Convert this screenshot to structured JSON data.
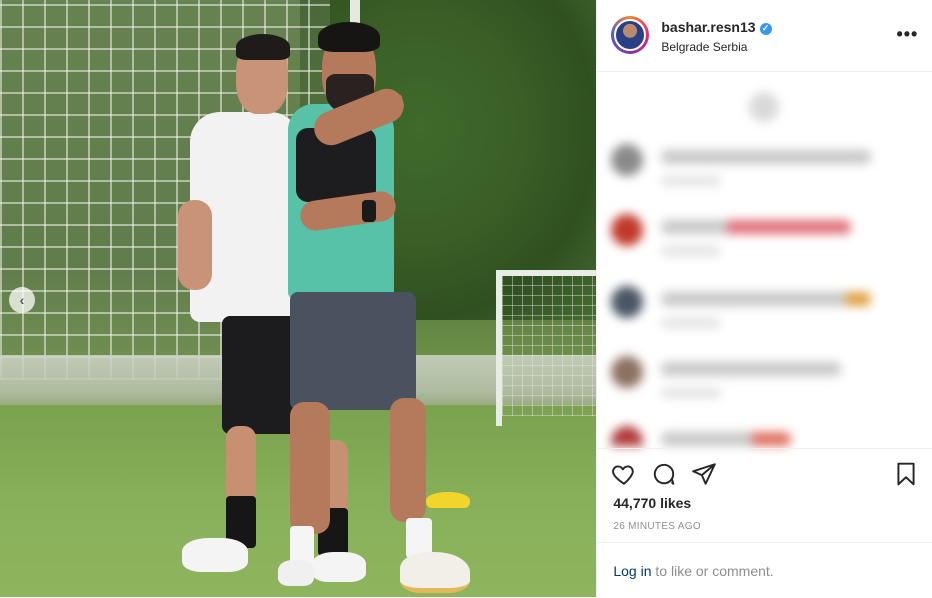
{
  "post": {
    "photo_alt": "",
    "prev_arrow": "‹"
  },
  "header": {
    "username": "bashar.resn13",
    "verified_glyph": "✓",
    "location": "Belgrade Serbia",
    "more_glyph": "•••"
  },
  "actions": {
    "likes": "44,770 likes",
    "timestamp": "26 MINUTES AGO"
  },
  "footer": {
    "login_link": "Log in",
    "login_rest": " to like or comment."
  },
  "icons": {
    "heart": "heart-icon",
    "comment": "comment-icon",
    "share": "share-icon",
    "save": "bookmark-icon"
  },
  "colors": {
    "link": "#00376b",
    "verified": "#3897f0",
    "text": "#262626",
    "muted": "#8e8e8e"
  }
}
